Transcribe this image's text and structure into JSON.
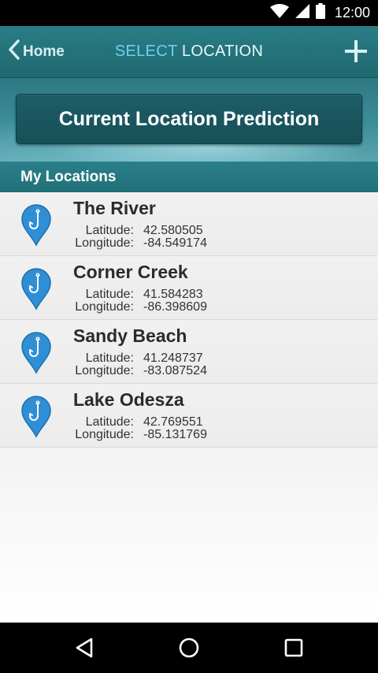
{
  "status_bar": {
    "time": "12:00",
    "icons": [
      "wifi-icon",
      "signal-icon",
      "battery-icon"
    ]
  },
  "app_bar": {
    "back_label": "Home",
    "title_part1": "SELECT",
    "title_part2": "LOCATION",
    "add_icon": "plus-icon",
    "colors": {
      "bar": "#237279",
      "title_accent": "#6fd0f5"
    }
  },
  "hero": {
    "button_label": "Current Location Prediction"
  },
  "section": {
    "title": "My Locations"
  },
  "locations": [
    {
      "name": "The River",
      "lat_label": "Latitude:",
      "lat": "42.580505",
      "lon_label": "Longitude:",
      "lon": "-84.549174"
    },
    {
      "name": "Corner Creek",
      "lat_label": "Latitude:",
      "lat": "41.584283",
      "lon_label": "Longitude:",
      "lon": "-86.398609"
    },
    {
      "name": "Sandy Beach",
      "lat_label": "Latitude:",
      "lat": "41.248737",
      "lon_label": "Longitude:",
      "lon": "-83.087524"
    },
    {
      "name": "Lake Odesza",
      "lat_label": "Latitude:",
      "lat": "42.769551",
      "lon_label": "Longitude:",
      "lon": "-85.131769"
    }
  ],
  "nav_bar": {
    "buttons": [
      "back-nav-icon",
      "home-nav-icon",
      "recents-nav-icon"
    ]
  }
}
